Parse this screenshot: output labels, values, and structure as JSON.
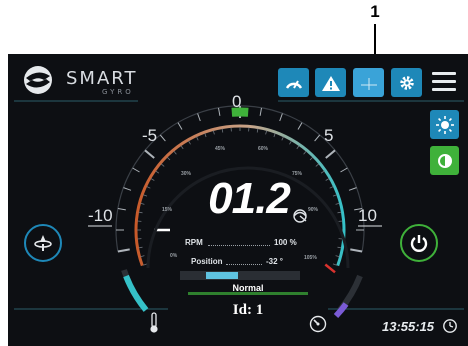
{
  "callout": {
    "number": "1"
  },
  "header": {
    "brand": "SMART",
    "brand_sub": "GYRO",
    "buttons": [
      {
        "name": "speedometer-button",
        "icon": "speedometer-icon"
      },
      {
        "name": "alarm-button",
        "icon": "warning-triangle-icon"
      },
      {
        "name": "level-button",
        "icon": "crosshair-level-icon"
      },
      {
        "name": "settings-button",
        "icon": "gear-icon"
      }
    ],
    "menu_icon": "hamburger-menu-icon"
  },
  "gauge": {
    "scale_labels": [
      "-10",
      "-5",
      "0",
      "5",
      "10"
    ],
    "percent_ticks": [
      "0%",
      "15%",
      "30%",
      "45%",
      "60%",
      "75%",
      "90%",
      "105%"
    ],
    "value": "01.2",
    "roll_value": 1.2,
    "rpm_label": "RPM",
    "rpm_value": "100 %",
    "position_label": "Position",
    "position_value": "-32 °",
    "status": "Normal",
    "id_label": "Id: 1",
    "rpm_fraction": 1.0,
    "temperature_level": "low",
    "colors": {
      "accent": "#1e88b8",
      "rpm_low": "#c85a2a",
      "rpm_high": "#35c1c8",
      "green": "#3fb13a",
      "red": "#d9322e",
      "purple": "#7a5bd6"
    }
  },
  "side": {
    "left_button_icon": "gyro-stabilizer-icon",
    "brightness_icon": "brightness-icon",
    "contrast_icon": "contrast-icon",
    "power_icon": "power-icon"
  },
  "footer": {
    "time": "13:55:15",
    "clock_icon": "clock-icon",
    "thermometer_icon": "thermometer-icon",
    "tachometer_icon": "tachometer-icon"
  }
}
